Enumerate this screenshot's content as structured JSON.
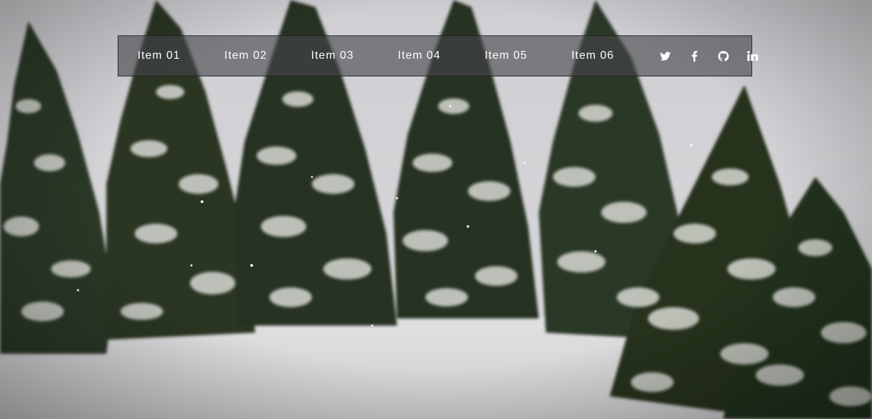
{
  "nav": {
    "items": [
      {
        "label": "Item 01"
      },
      {
        "label": "Item 02"
      },
      {
        "label": "Item 03"
      },
      {
        "label": "Item 04"
      },
      {
        "label": "Item 05"
      },
      {
        "label": "Item 06"
      }
    ],
    "social": [
      {
        "icon": "twitter-icon"
      },
      {
        "icon": "facebook-icon"
      },
      {
        "icon": "github-icon"
      },
      {
        "icon": "linkedin-icon"
      }
    ]
  },
  "colors": {
    "nav_bg": "#46464a",
    "nav_text": "#ffffff",
    "sky": "#cfcfd3",
    "snow": "#e6e6e8",
    "tree_dark": "#27331f",
    "tree_snow": "#d9dcd6"
  }
}
